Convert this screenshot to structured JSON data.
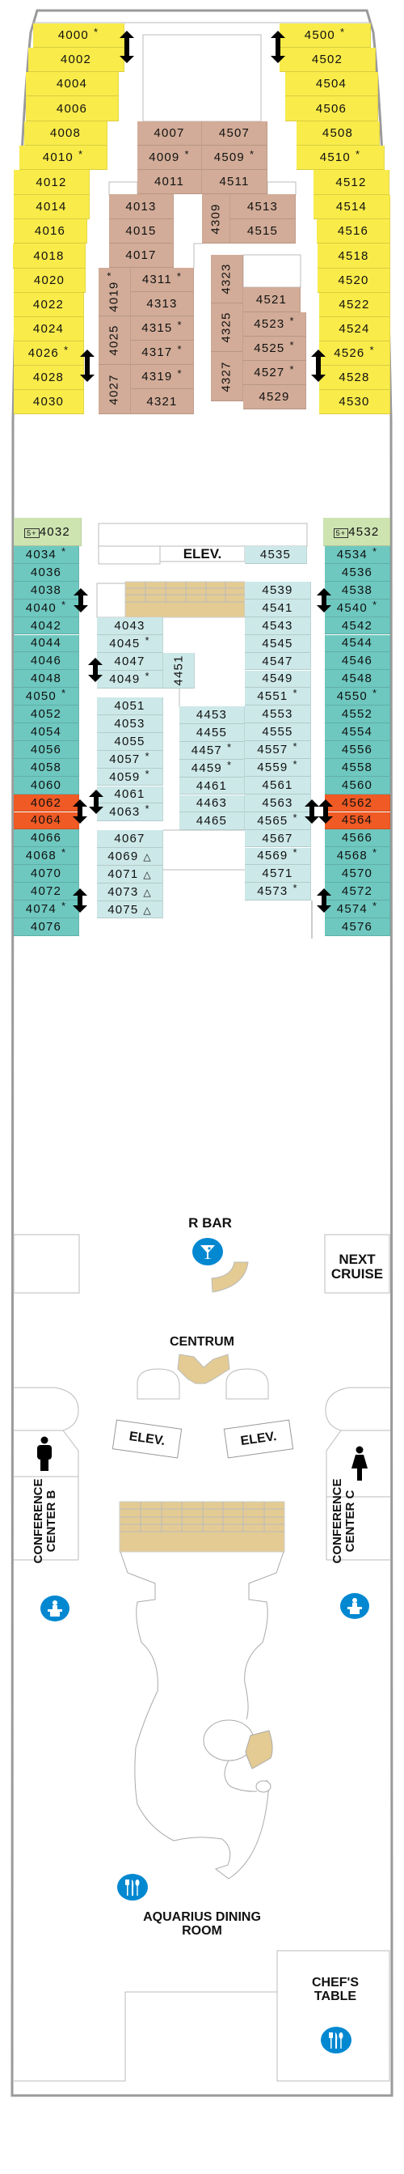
{
  "colors": {
    "yellow": "#F9EB4A",
    "brown": "#D2AC98",
    "green": "#CDE3B0",
    "teal": "#6EC8BF",
    "lightteal": "#CDE8E8",
    "orange": "#F05A24",
    "stairs": "#E3CB93",
    "icon_blue": "#0288D1"
  },
  "cabins": [
    {
      "number": "4000",
      "mark": "*",
      "cat": "yellow"
    },
    {
      "number": "4002",
      "mark": "",
      "cat": "yellow"
    },
    {
      "number": "4004",
      "mark": "",
      "cat": "yellow"
    },
    {
      "number": "4006",
      "mark": "",
      "cat": "yellow"
    },
    {
      "number": "4008",
      "mark": "",
      "cat": "yellow"
    },
    {
      "number": "4010",
      "mark": "*",
      "cat": "yellow"
    },
    {
      "number": "4012",
      "mark": "",
      "cat": "yellow"
    },
    {
      "number": "4014",
      "mark": "",
      "cat": "yellow"
    },
    {
      "number": "4016",
      "mark": "",
      "cat": "yellow"
    },
    {
      "number": "4018",
      "mark": "",
      "cat": "yellow"
    },
    {
      "number": "4020",
      "mark": "",
      "cat": "yellow"
    },
    {
      "number": "4022",
      "mark": "",
      "cat": "yellow"
    },
    {
      "number": "4024",
      "mark": "",
      "cat": "yellow"
    },
    {
      "number": "4026",
      "mark": "*",
      "cat": "yellow"
    },
    {
      "number": "4028",
      "mark": "",
      "cat": "yellow"
    },
    {
      "number": "4030",
      "mark": "",
      "cat": "yellow"
    },
    {
      "number": "4500",
      "mark": "*",
      "cat": "yellow"
    },
    {
      "number": "4502",
      "mark": "",
      "cat": "yellow"
    },
    {
      "number": "4504",
      "mark": "",
      "cat": "yellow"
    },
    {
      "number": "4506",
      "mark": "",
      "cat": "yellow"
    },
    {
      "number": "4508",
      "mark": "",
      "cat": "yellow"
    },
    {
      "number": "4510",
      "mark": "*",
      "cat": "yellow"
    },
    {
      "number": "4512",
      "mark": "",
      "cat": "yellow"
    },
    {
      "number": "4514",
      "mark": "",
      "cat": "yellow"
    },
    {
      "number": "4516",
      "mark": "",
      "cat": "yellow"
    },
    {
      "number": "4518",
      "mark": "",
      "cat": "yellow"
    },
    {
      "number": "4520",
      "mark": "",
      "cat": "yellow"
    },
    {
      "number": "4522",
      "mark": "",
      "cat": "yellow"
    },
    {
      "number": "4524",
      "mark": "",
      "cat": "yellow"
    },
    {
      "number": "4526",
      "mark": "*",
      "cat": "yellow"
    },
    {
      "number": "4528",
      "mark": "",
      "cat": "yellow"
    },
    {
      "number": "4530",
      "mark": "",
      "cat": "yellow"
    },
    {
      "number": "4007",
      "mark": "",
      "cat": "brown"
    },
    {
      "number": "4507",
      "mark": "",
      "cat": "brown"
    },
    {
      "number": "4009",
      "mark": "*",
      "cat": "brown"
    },
    {
      "number": "4509",
      "mark": "*",
      "cat": "brown"
    },
    {
      "number": "4011",
      "mark": "",
      "cat": "brown"
    },
    {
      "number": "4511",
      "mark": "",
      "cat": "brown"
    },
    {
      "number": "4013",
      "mark": "",
      "cat": "brown"
    },
    {
      "number": "4015",
      "mark": "",
      "cat": "brown"
    },
    {
      "number": "4017",
      "mark": "",
      "cat": "brown"
    },
    {
      "number": "4309",
      "mark": "",
      "cat": "brown"
    },
    {
      "number": "4513",
      "mark": "",
      "cat": "brown"
    },
    {
      "number": "4515",
      "mark": "",
      "cat": "brown"
    },
    {
      "number": "4019",
      "mark": "*",
      "cat": "brown"
    },
    {
      "number": "4311",
      "mark": "*",
      "cat": "brown"
    },
    {
      "number": "4313",
      "mark": "",
      "cat": "brown"
    },
    {
      "number": "4025",
      "mark": "",
      "cat": "brown"
    },
    {
      "number": "4315",
      "mark": "*",
      "cat": "brown"
    },
    {
      "number": "4317",
      "mark": "*",
      "cat": "brown"
    },
    {
      "number": "4027",
      "mark": "",
      "cat": "brown"
    },
    {
      "number": "4319",
      "mark": "*",
      "cat": "brown"
    },
    {
      "number": "4321",
      "mark": "",
      "cat": "brown"
    },
    {
      "number": "4323",
      "mark": "",
      "cat": "brown"
    },
    {
      "number": "4521",
      "mark": "",
      "cat": "brown"
    },
    {
      "number": "4325",
      "mark": "",
      "cat": "brown"
    },
    {
      "number": "4523",
      "mark": "*",
      "cat": "brown"
    },
    {
      "number": "4525",
      "mark": "*",
      "cat": "brown"
    },
    {
      "number": "4327",
      "mark": "",
      "cat": "brown"
    },
    {
      "number": "4527",
      "mark": "*",
      "cat": "brown"
    },
    {
      "number": "4529",
      "mark": "",
      "cat": "brown"
    },
    {
      "number": "4032",
      "mark": "",
      "cat": "green",
      "accessible": "5+"
    },
    {
      "number": "4532",
      "mark": "",
      "cat": "green",
      "accessible": "5+"
    },
    {
      "number": "4034",
      "mark": "*",
      "cat": "teal"
    },
    {
      "number": "4036",
      "mark": "",
      "cat": "teal"
    },
    {
      "number": "4038",
      "mark": "",
      "cat": "teal"
    },
    {
      "number": "4040",
      "mark": "*",
      "cat": "teal"
    },
    {
      "number": "4042",
      "mark": "",
      "cat": "teal"
    },
    {
      "number": "4044",
      "mark": "",
      "cat": "teal"
    },
    {
      "number": "4046",
      "mark": "",
      "cat": "teal"
    },
    {
      "number": "4048",
      "mark": "",
      "cat": "teal"
    },
    {
      "number": "4050",
      "mark": "*",
      "cat": "teal"
    },
    {
      "number": "4052",
      "mark": "",
      "cat": "teal"
    },
    {
      "number": "4054",
      "mark": "",
      "cat": "teal"
    },
    {
      "number": "4056",
      "mark": "",
      "cat": "teal"
    },
    {
      "number": "4058",
      "mark": "",
      "cat": "teal"
    },
    {
      "number": "4060",
      "mark": "",
      "cat": "teal"
    },
    {
      "number": "4062",
      "mark": "",
      "cat": "orange"
    },
    {
      "number": "4064",
      "mark": "",
      "cat": "orange"
    },
    {
      "number": "4066",
      "mark": "",
      "cat": "teal"
    },
    {
      "number": "4068",
      "mark": "*",
      "cat": "teal"
    },
    {
      "number": "4070",
      "mark": "",
      "cat": "teal"
    },
    {
      "number": "4072",
      "mark": "",
      "cat": "teal"
    },
    {
      "number": "4074",
      "mark": "*",
      "cat": "teal"
    },
    {
      "number": "4076",
      "mark": "",
      "cat": "teal"
    },
    {
      "number": "4534",
      "mark": "*",
      "cat": "teal"
    },
    {
      "number": "4536",
      "mark": "",
      "cat": "teal"
    },
    {
      "number": "4538",
      "mark": "",
      "cat": "teal"
    },
    {
      "number": "4540",
      "mark": "*",
      "cat": "teal"
    },
    {
      "number": "4542",
      "mark": "",
      "cat": "teal"
    },
    {
      "number": "4544",
      "mark": "",
      "cat": "teal"
    },
    {
      "number": "4546",
      "mark": "",
      "cat": "teal"
    },
    {
      "number": "4548",
      "mark": "",
      "cat": "teal"
    },
    {
      "number": "4550",
      "mark": "*",
      "cat": "teal"
    },
    {
      "number": "4552",
      "mark": "",
      "cat": "teal"
    },
    {
      "number": "4554",
      "mark": "",
      "cat": "teal"
    },
    {
      "number": "4556",
      "mark": "",
      "cat": "teal"
    },
    {
      "number": "4558",
      "mark": "",
      "cat": "teal"
    },
    {
      "number": "4560",
      "mark": "",
      "cat": "teal"
    },
    {
      "number": "4562",
      "mark": "",
      "cat": "orange"
    },
    {
      "number": "4564",
      "mark": "",
      "cat": "orange"
    },
    {
      "number": "4566",
      "mark": "",
      "cat": "teal"
    },
    {
      "number": "4568",
      "mark": "*",
      "cat": "teal"
    },
    {
      "number": "4570",
      "mark": "",
      "cat": "teal"
    },
    {
      "number": "4572",
      "mark": "",
      "cat": "teal"
    },
    {
      "number": "4574",
      "mark": "*",
      "cat": "teal"
    },
    {
      "number": "4576",
      "mark": "",
      "cat": "teal"
    },
    {
      "number": "4535",
      "mark": "",
      "cat": "lightteal"
    },
    {
      "number": "4539",
      "mark": "",
      "cat": "lightteal"
    },
    {
      "number": "4541",
      "mark": "",
      "cat": "lightteal"
    },
    {
      "number": "4543",
      "mark": "",
      "cat": "lightteal"
    },
    {
      "number": "4545",
      "mark": "",
      "cat": "lightteal"
    },
    {
      "number": "4547",
      "mark": "",
      "cat": "lightteal"
    },
    {
      "number": "4549",
      "mark": "",
      "cat": "lightteal"
    },
    {
      "number": "4551",
      "mark": "*",
      "cat": "lightteal"
    },
    {
      "number": "4553",
      "mark": "",
      "cat": "lightteal"
    },
    {
      "number": "4555",
      "mark": "",
      "cat": "lightteal"
    },
    {
      "number": "4557",
      "mark": "*",
      "cat": "lightteal"
    },
    {
      "number": "4559",
      "mark": "*",
      "cat": "lightteal"
    },
    {
      "number": "4561",
      "mark": "",
      "cat": "lightteal"
    },
    {
      "number": "4563",
      "mark": "",
      "cat": "lightteal"
    },
    {
      "number": "4565",
      "mark": "*",
      "cat": "lightteal"
    },
    {
      "number": "4567",
      "mark": "",
      "cat": "lightteal"
    },
    {
      "number": "4569",
      "mark": "*",
      "cat": "lightteal"
    },
    {
      "number": "4571",
      "mark": "",
      "cat": "lightteal"
    },
    {
      "number": "4573",
      "mark": "*",
      "cat": "lightteal"
    },
    {
      "number": "4043",
      "mark": "",
      "cat": "lightteal"
    },
    {
      "number": "4045",
      "mark": "*",
      "cat": "lightteal"
    },
    {
      "number": "4047",
      "mark": "",
      "cat": "lightteal"
    },
    {
      "number": "4049",
      "mark": "*",
      "cat": "lightteal"
    },
    {
      "number": "4451",
      "mark": "",
      "cat": "lightteal"
    },
    {
      "number": "4051",
      "mark": "",
      "cat": "lightteal"
    },
    {
      "number": "4053",
      "mark": "",
      "cat": "lightteal"
    },
    {
      "number": "4055",
      "mark": "",
      "cat": "lightteal"
    },
    {
      "number": "4057",
      "mark": "*",
      "cat": "lightteal"
    },
    {
      "number": "4059",
      "mark": "*",
      "cat": "lightteal"
    },
    {
      "number": "4061",
      "mark": "",
      "cat": "lightteal"
    },
    {
      "number": "4063",
      "mark": "*",
      "cat": "lightteal"
    },
    {
      "number": "4067",
      "mark": "",
      "cat": "lightteal"
    },
    {
      "number": "4069",
      "mark": "△",
      "cat": "lightteal"
    },
    {
      "number": "4071",
      "mark": "△",
      "cat": "lightteal"
    },
    {
      "number": "4073",
      "mark": "△",
      "cat": "lightteal"
    },
    {
      "number": "4075",
      "mark": "△",
      "cat": "lightteal"
    },
    {
      "number": "4453",
      "mark": "",
      "cat": "lightteal"
    },
    {
      "number": "4455",
      "mark": "",
      "cat": "lightteal"
    },
    {
      "number": "4457",
      "mark": "*",
      "cat": "lightteal"
    },
    {
      "number": "4459",
      "mark": "*",
      "cat": "lightteal"
    },
    {
      "number": "4461",
      "mark": "",
      "cat": "lightteal"
    },
    {
      "number": "4463",
      "mark": "",
      "cat": "lightteal"
    },
    {
      "number": "4465",
      "mark": "",
      "cat": "lightteal"
    }
  ],
  "labels": {
    "elev_top": "ELEV.",
    "r_bar": "R BAR",
    "next_cruise": "NEXT CRUISE",
    "centrum": "CENTRUM",
    "elev_left": "ELEV.",
    "elev_right": "ELEV.",
    "conf_b": "CONFERENCE CENTER B",
    "conf_c": "CONFERENCE CENTER C",
    "aquarius": "AQUARIUS DINING ROOM",
    "chefs_table": "CHEF'S TABLE"
  },
  "icons": [
    "cocktail-icon",
    "men-restroom-icon",
    "women-restroom-icon",
    "podium-icon",
    "dining-icon",
    "elevator-arrow-icon",
    "accessible-cabin-icon"
  ]
}
